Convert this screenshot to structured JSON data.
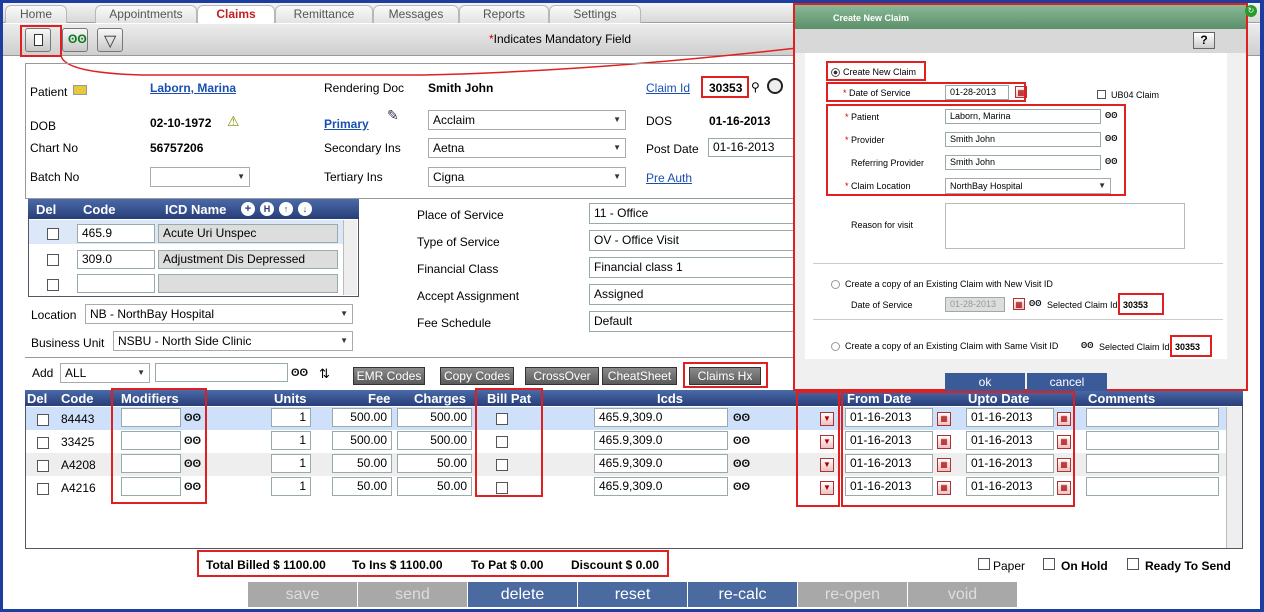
{
  "tabs": [
    "Home",
    "Appointments",
    "Claims",
    "Remittance",
    "Messages",
    "Reports",
    "Settings"
  ],
  "toolbar": {
    "new_icon": "new-document-icon",
    "search_icon": "binoculars-icon",
    "filter_icon": "filter-icon",
    "mandatory_star": "*",
    "mandatory_text": "Indicates Mandatory Field"
  },
  "header": {
    "patient_label": "Patient",
    "patient_value": "Laborn, Marina",
    "dob_label": "DOB",
    "dob_value": "02-10-1972",
    "chart_label": "Chart No",
    "chart_value": "56757206",
    "batch_label": "Batch No",
    "rendering_label": "Rendering Doc",
    "rendering_value": "Smith John",
    "primary_label": "Primary",
    "primary_value": "Acclaim",
    "secondary_label": "Secondary Ins",
    "secondary_value": "Aetna",
    "tertiary_label": "Tertiary Ins",
    "tertiary_value": "Cigna",
    "claimid_label": "Claim Id",
    "claimid_value": "30353",
    "dos_label": "DOS",
    "dos_value": "01-16-2013",
    "post_label": "Post Date",
    "post_value": "01-16-2013",
    "preauth_label": "Pre Auth"
  },
  "icd": {
    "headers": {
      "del": "Del",
      "code": "Code",
      "name": "ICD Name"
    },
    "rows": [
      {
        "code": "465.9",
        "name": "Acute Uri Unspec"
      },
      {
        "code": "309.0",
        "name": "Adjustment Dis Depressed"
      },
      {
        "code": "",
        "name": ""
      }
    ]
  },
  "location": {
    "label": "Location",
    "value": "NB - NorthBay Hospital"
  },
  "business": {
    "label": "Business Unit",
    "value": "NSBU - North Side Clinic"
  },
  "service": [
    {
      "label": "Place of Service",
      "value": "11 - Office"
    },
    {
      "label": "Type of Service",
      "value": "OV - Office Visit"
    },
    {
      "label": "Financial Class",
      "value": "Financial class 1"
    },
    {
      "label": "Accept Assignment",
      "value": "Assigned"
    },
    {
      "label": "Fee Schedule",
      "value": "Default"
    }
  ],
  "addbar": {
    "label": "Add",
    "value": "ALL",
    "buttons": [
      "EMR Codes",
      "Copy Codes",
      "CrossOver",
      "CheatSheet",
      "Claims Hx"
    ]
  },
  "lines": {
    "headers": {
      "del": "Del",
      "code": "Code",
      "modifiers": "Modifiers",
      "units": "Units",
      "fee": "Fee",
      "charges": "Charges",
      "billpat": "Bill Pat",
      "icds": "Icds",
      "from": "From Date",
      "upto": "Upto Date",
      "comments": "Comments"
    },
    "rows": [
      {
        "code": "84443",
        "units": "1",
        "fee": "500.00",
        "charges": "500.00",
        "icds": "465.9,309.0",
        "from": "01-16-2013",
        "upto": "01-16-2013"
      },
      {
        "code": "33425",
        "units": "1",
        "fee": "500.00",
        "charges": "500.00",
        "icds": "465.9,309.0",
        "from": "01-16-2013",
        "upto": "01-16-2013"
      },
      {
        "code": "A4208",
        "units": "1",
        "fee": "50.00",
        "charges": "50.00",
        "icds": "465.9,309.0",
        "from": "01-16-2013",
        "upto": "01-16-2013"
      },
      {
        "code": "A4216",
        "units": "1",
        "fee": "50.00",
        "charges": "50.00",
        "icds": "465.9,309.0",
        "from": "01-16-2013",
        "upto": "01-16-2013"
      }
    ]
  },
  "totals": {
    "billed": "Total Billed $ 1100.00",
    "toins": "To Ins $ 1100.00",
    "topat": "To Pat $ 0.00",
    "discount": "Discount $ 0.00"
  },
  "flags": {
    "paper": "Paper",
    "onhold": "On Hold",
    "ready": "Ready To Send"
  },
  "actions": [
    "save",
    "send",
    "delete",
    "reset",
    "re-calc",
    "re-open",
    "void"
  ],
  "modal": {
    "title": "Create New Claim",
    "help": "?",
    "option1": "Create New Claim",
    "dos_label": "Date of Service",
    "dos_value": "01-28-2013",
    "ub04": "UB04 Claim",
    "patient_label": "Patient",
    "patient_value": "Laborn, Marina",
    "provider_label": "Provider",
    "provider_value": "Smith John",
    "referring_label": "Referring Provider",
    "referring_value": "Smith John",
    "location_label": "Claim Location",
    "location_value": "NorthBay Hospital",
    "reason_label": "Reason for visit",
    "option2": "Create a copy of an Existing Claim with New Visit ID",
    "copy_dos_label": "Date of Service",
    "copy_dos_value": "01-28-2013",
    "selected_label": "Selected Claim Id",
    "selected_value": "30353",
    "option3": "Create a copy of an Existing Claim with Same Visit ID",
    "selected2_label": "Selected Claim Id",
    "selected2_value": "30353",
    "ok": "ok",
    "cancel": "cancel"
  }
}
